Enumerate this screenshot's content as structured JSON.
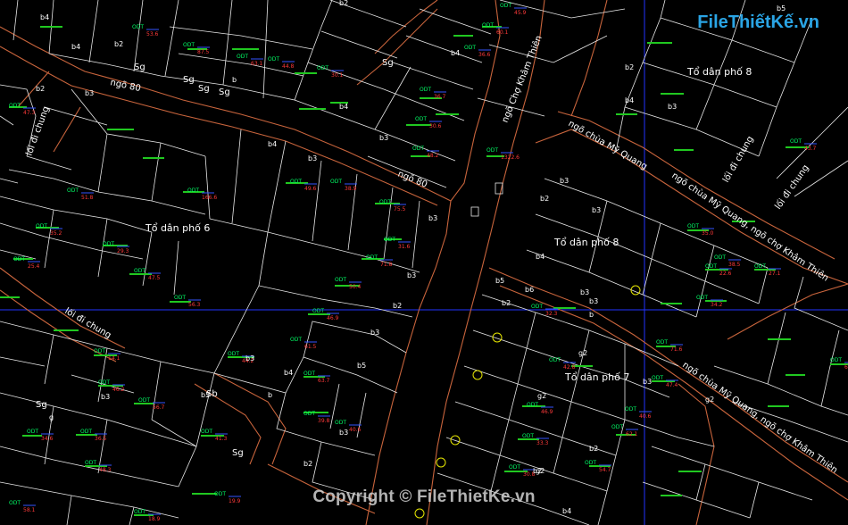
{
  "watermark": {
    "logo": "FileThiếtKế.vn",
    "copyright": "Copyright © FileThietKe.vn"
  },
  "colors": {
    "background": "#000000",
    "parcel_line": "#ffffff",
    "road_edge": "#c8643c",
    "axis_line": "#2233ff",
    "label_green": "#20c820",
    "odt_text": "#00ff66",
    "area_text": "#ff3a3a",
    "road_text": "#ffffff"
  },
  "road_labels": [
    "ngõ 80",
    "ngõ 80",
    "ngõ Chợ Khâm Thiên",
    "ngõ chùa Mỹ Quang",
    "ngõ chùa Mỹ Quang, ngõ chợ Khâm Thiên",
    "ngõ chùa Mỹ Quang, ngõ chợ Khâm Thiên",
    "lối đi chung",
    "lối đi chung",
    "lối đi chung",
    "lối đi chung"
  ],
  "area_labels": [
    "Tổ dân phố 6",
    "Tổ dân phố 7",
    "Tổ dân phố 8",
    "Tổ dân phố 8"
  ],
  "block_labels": [
    "b4",
    "b4",
    "b2",
    "Sg",
    "Sg",
    "Sg",
    "Sg",
    "b",
    "b2",
    "b3",
    "b4",
    "b3",
    "b2",
    "b4",
    "b3",
    "Sg",
    "b3",
    "b4",
    "b3",
    "b2",
    "b3",
    "b5",
    "b5",
    "b3",
    "b4",
    "b3",
    "b2",
    "b2",
    "b5",
    "b6",
    "b2",
    "g2",
    "g2",
    "g2",
    "b3",
    "b3",
    "b4",
    "b3",
    "b2",
    "b3",
    "b2",
    "b5",
    "b4",
    "b2",
    "Sg",
    "b3",
    "Sg",
    "g",
    "Sb",
    "b3",
    "b",
    "b3",
    "b",
    "g2",
    "b4"
  ],
  "parcel_codes": {
    "code": "ODT",
    "areas": [
      "53.6",
      "87.5",
      "63.1",
      "44.8",
      "30.1",
      "1322.6",
      "36.7",
      "30.6",
      "48.2",
      "36.6",
      "60.1",
      "45.9",
      "47.3",
      "166.6",
      "49.6",
      "38.9",
      "75.5",
      "31.6",
      "71.8",
      "50.4",
      "46.9",
      "61.5",
      "44.2",
      "63.7",
      "39.8",
      "40.6",
      "29.3",
      "51.8",
      "35.2",
      "25.4",
      "47.5",
      "56.3",
      "14.1",
      "46.2",
      "56.7",
      "41.3",
      "36.5",
      "34.6",
      "48.3",
      "19.9",
      "18.9",
      "58.1",
      "32.3",
      "42.8",
      "46.9",
      "33.3",
      "30.8",
      "54.7",
      "62.1",
      "40.6",
      "47.4",
      "71.6",
      "34.2",
      "22.6",
      "35.0",
      "38.5",
      "27.1",
      "43.7",
      "60.3"
    ]
  }
}
